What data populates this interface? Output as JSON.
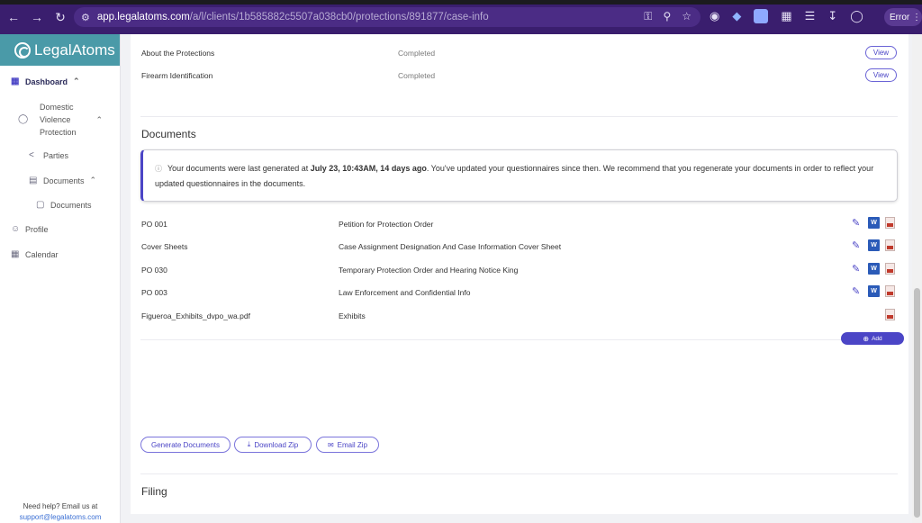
{
  "browser": {
    "url_host": "app.legalatoms.com",
    "url_path": "/a/l/clients/1b585882c5507a038cb0/protections/891877/case-info",
    "error_label": "Error"
  },
  "sidebar": {
    "logo": "LegalAtoms",
    "dashboard": "Dashboard",
    "domestic_violence": [
      "Domestic",
      "Violence",
      "Protection"
    ],
    "parties": "Parties",
    "documents_group": "Documents",
    "documents_item": "Documents",
    "profile": "Profile",
    "calendar": "Calendar",
    "help_text": "Need help? Email us at",
    "help_email": "support@legalatoms.com"
  },
  "protections": {
    "rows": [
      {
        "name": "About the Protections",
        "status": "Completed",
        "action": "View"
      },
      {
        "name": "Firearm Identification",
        "status": "Completed",
        "action": "View"
      }
    ]
  },
  "documents": {
    "title": "Documents",
    "alert": {
      "prefix": "Your documents were last generated at ",
      "timestamp": "July 23, 10:43AM, 14 days ago",
      "suffix": ". You've updated your questionnaires since then. We recommend that you regenerate your documents in order to reflect your updated questionnaires in the documents."
    },
    "items": [
      {
        "code": "PO 001",
        "title": "Petition for Protection Order",
        "editable": true
      },
      {
        "code": "Cover Sheets",
        "title": "Case Assignment Designation And Case Information Cover Sheet",
        "editable": true
      },
      {
        "code": "PO 030",
        "title": "Temporary Protection Order and Hearing Notice King",
        "editable": true
      },
      {
        "code": "PO 003",
        "title": "Law Enforcement and Confidential Info",
        "editable": true
      },
      {
        "code": "Figueroa_Exhibits_dvpo_wa.pdf",
        "title": "Exhibits",
        "editable": false
      }
    ],
    "add_label": "Add",
    "generate_label": "Generate Documents",
    "download_label": "Download Zip",
    "email_label": "Email Zip"
  },
  "filing": {
    "title": "Filing"
  },
  "colors": {
    "accent": "#4b45c6",
    "logo_bg": "#4a9aa8",
    "browser_bg": "#3a1e6e"
  }
}
